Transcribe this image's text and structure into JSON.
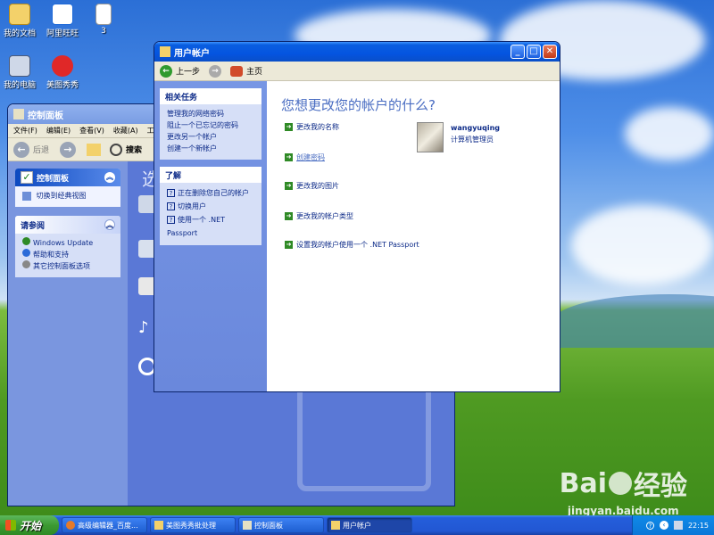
{
  "desktop": {
    "icons": [
      {
        "label": "我的文档"
      },
      {
        "label": "阿里旺旺"
      },
      {
        "label": "3"
      },
      {
        "label": "我的电脑"
      },
      {
        "label": "美图秀秀"
      }
    ]
  },
  "control_panel": {
    "title": "控制面板",
    "menu": [
      "文件(F)",
      "编辑(E)",
      "查看(V)",
      "收藏(A)",
      "工"
    ],
    "toolbar": {
      "back": "后退",
      "search": "搜索"
    },
    "side": {
      "main_header": "控制面板",
      "switch_label": "切换到经典视图",
      "see_also_header": "请参阅",
      "see_also": [
        "Windows Update",
        "帮助和支持",
        "其它控制面板选项"
      ]
    },
    "content_heading": "选"
  },
  "user_accounts": {
    "title": "用户帐户",
    "toolbar": {
      "back": "上一步",
      "home": "主页"
    },
    "related_header": "相关任务",
    "related": [
      "管理我的网络密码",
      "阻止一个已忘记的密码",
      "更改另一个帐户",
      "创建一个新帐户"
    ],
    "learn_header": "了解",
    "learn": [
      "正在删除您自己的帐户",
      "切换用户",
      "使用一个 .NET Passport"
    ],
    "heading": "您想更改您的帐户的什么?",
    "actions": [
      "更改我的名称",
      "创建密码",
      "更改我的图片",
      "更改我的帐户类型",
      "设置我的帐户使用一个 .NET Passport"
    ],
    "user": {
      "name": "wangyuqing",
      "role": "计算机管理员"
    }
  },
  "taskbar": {
    "start": "开始",
    "items": [
      "高级编辑器_百度...",
      "美图秀秀批处理",
      "控制面板",
      "用户帐户"
    ],
    "time": "22:15"
  },
  "watermark": {
    "brand": "Bai",
    "suffix": "经验",
    "url": "jingyan.baidu.com"
  }
}
